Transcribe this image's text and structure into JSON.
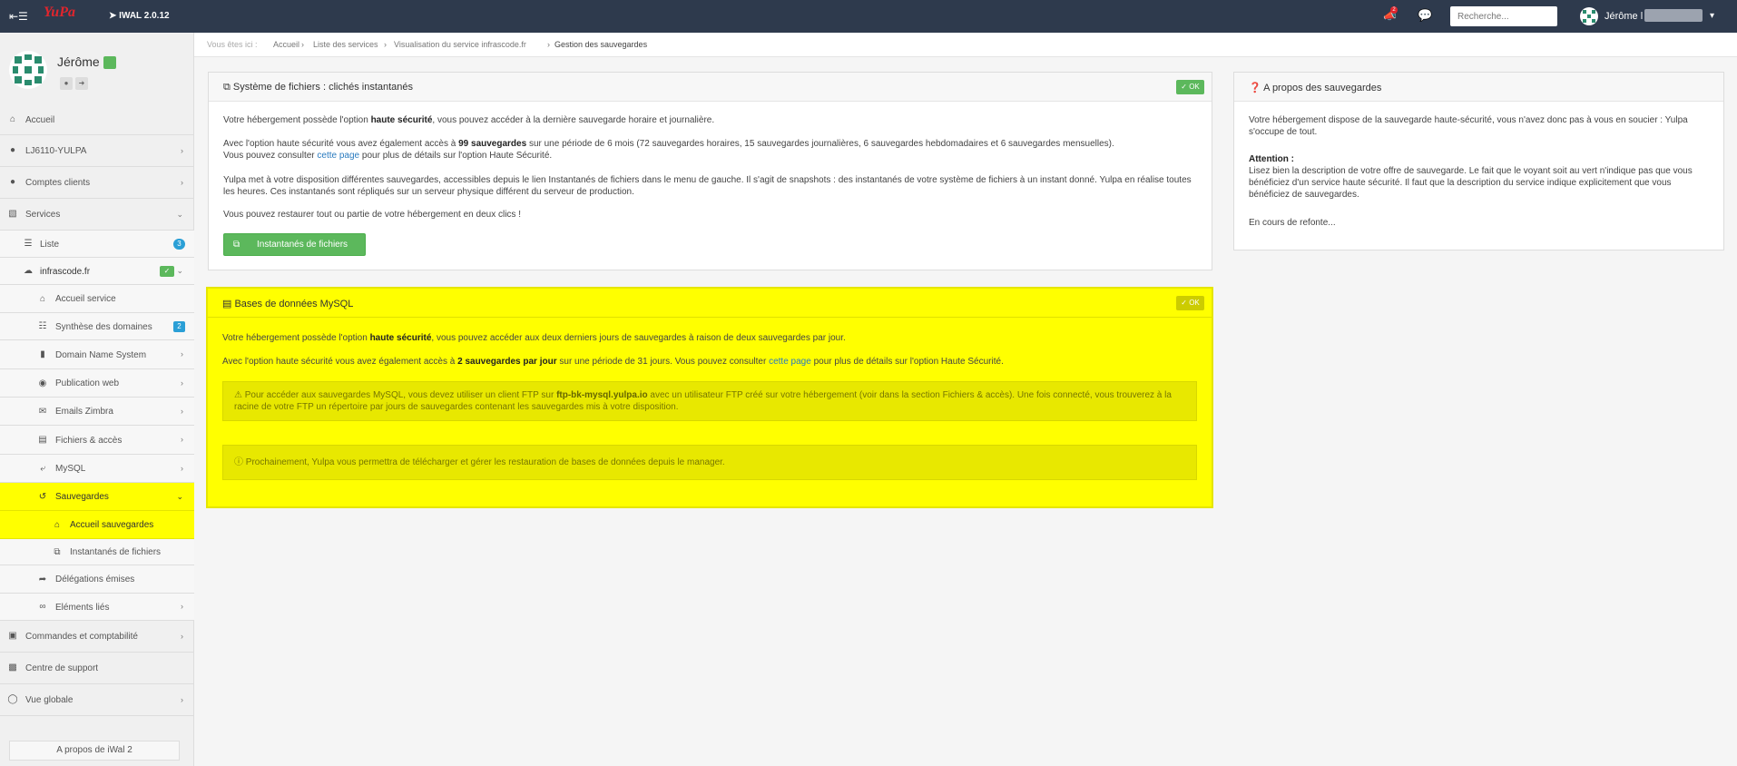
{
  "topbar": {
    "menu_icon": "menu-toggle-icon",
    "logo": "YuPa",
    "version": "IWAL 2.0.12",
    "notif_count": "2",
    "search_placeholder": "Recherche...",
    "user_name": "Jérôme l"
  },
  "sidebar": {
    "profile_name": "Jérôme",
    "items": [
      {
        "label": "Accueil",
        "icon": "home-icon"
      },
      {
        "label": "LJ6110-YULPA",
        "icon": "user-icon"
      },
      {
        "label": "Comptes clients",
        "icon": "users-icon"
      },
      {
        "label": "Services",
        "icon": "cubes-icon"
      },
      {
        "label": "Liste",
        "icon": "list-icon",
        "badge": "3"
      },
      {
        "label": "infrascode.fr",
        "icon": "cloud-icon"
      },
      {
        "label": "Accueil service",
        "icon": "home-icon"
      },
      {
        "label": "Synthèse des domaines",
        "icon": "sitemap-icon",
        "badge": "2"
      },
      {
        "label": "Domain Name System",
        "icon": "book-icon"
      },
      {
        "label": "Publication web",
        "icon": "globe-icon"
      },
      {
        "label": "Emails Zimbra",
        "icon": "envelope-icon"
      },
      {
        "label": "Fichiers & accès",
        "icon": "files-icon"
      },
      {
        "label": "MySQL",
        "icon": "dolphin-icon"
      },
      {
        "label": "Sauvegardes",
        "icon": "history-icon"
      },
      {
        "label": "Accueil sauvegardes",
        "icon": "home-icon"
      },
      {
        "label": "Instantanés de fichiers",
        "icon": "copy-icon"
      },
      {
        "label": "Délégations émises",
        "icon": "share-icon"
      },
      {
        "label": "Eléments liés",
        "icon": "link-icon"
      },
      {
        "label": "Commandes et comptabilité",
        "icon": "cart-icon"
      },
      {
        "label": "Centre de support",
        "icon": "briefcase-icon"
      },
      {
        "label": "Vue globale",
        "icon": "binoculars-icon"
      }
    ],
    "about": "A propos de iWal 2"
  },
  "breadcrumb": {
    "prefix": "Vous êtes ici :",
    "items": [
      "Accueil",
      "Liste des services",
      "Visualisation du service infrascode.fr",
      "Gestion des sauvegardes"
    ]
  },
  "files_panel": {
    "title": "Système de fichiers : clichés instantanés",
    "ok": "OK",
    "p1_a": "Votre hébergement possède l'option ",
    "p1_b": "haute sécurité",
    "p1_c": ", vous pouvez accéder à la dernière sauvegarde horaire et journalière.",
    "p2_a": "Avec l'option haute sécurité vous avez également accès à ",
    "p2_b": "99 sauvegardes",
    "p2_c": " sur une période de 6 mois (72 sauvegardes horaires, 15 sauvegardes journalières, 6 sauvegardes hebdomadaires et 6 sauvegardes mensuelles).",
    "p2_d": "Vous pouvez consulter ",
    "p2_link": "cette page",
    "p2_e": " pour plus de détails sur l'option Haute Sécurité.",
    "p3": "Yulpa met à votre disposition différentes sauvegardes, accessibles depuis le lien Instantanés de fichiers dans le menu de gauche. Il s'agit de snapshots : des instantanés de votre système de fichiers à un instant donné. Yulpa en réalise toutes les heures. Ces instantanés sont répliqués sur un serveur physique différent du serveur de production.",
    "p4": "Vous pouvez restaurer tout ou partie de votre hébergement en deux clics !",
    "button": "Instantanés de fichiers"
  },
  "mysql_panel": {
    "title": "Bases de données MySQL",
    "ok": "OK",
    "p1_a": "Votre hébergement possède l'option ",
    "p1_b": "haute sécurité",
    "p1_c": ", vous pouvez accéder aux deux derniers jours de sauvegardes à raison de deux sauvegardes par jour.",
    "p2_a": "Avec l'option haute sécurité vous avez également accès à ",
    "p2_b": "2 sauvegardes par jour",
    "p2_c": " sur une période de 31 jours. Vous pouvez consulter ",
    "p2_link": "cette page",
    "p2_d": " pour plus de détails sur l'option Haute Sécurité.",
    "alert1_a": "Pour accéder aux sauvegardes MySQL, vous devez utiliser un client FTP sur ",
    "alert1_b": "ftp-bk-mysql.yulpa.io",
    "alert1_c": " avec un utilisateur FTP créé sur votre hébergement (voir dans la section Fichiers & accès). Une fois connecté, vous trouverez à la racine de votre FTP un répertoire par jours de sauvegardes contenant les sauvegardes mis à votre disposition.",
    "alert2": "Prochainement, Yulpa vous permettra de télécharger et gérer les restauration de bases de données depuis le manager."
  },
  "about_panel": {
    "title": "A propos des sauvegardes",
    "p1": "Votre hébergement dispose de la sauvegarde haute-sécurité, vous n'avez donc pas à vous en soucier : Yulpa s'occupe de tout.",
    "attention": "Attention :",
    "p2": "Lisez bien la description de votre offre de sauvegarde. Le fait que le voyant soit au vert n'indique pas que vous bénéficiez d'un service haute sécurité. Il faut que la description du service indique explicitement que vous bénéficiez de sauvegardes.",
    "p3": "En cours de refonte..."
  }
}
